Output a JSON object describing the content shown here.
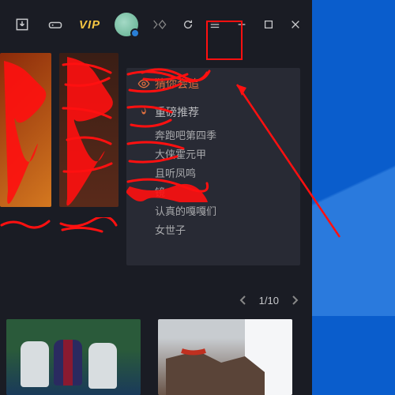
{
  "titlebar": {
    "vip_label": "VIP"
  },
  "dropdown": {
    "header": "猜你会追",
    "section_title": "重磅推荐",
    "items": [
      "奔跑吧第四季",
      "大侠霍元甲",
      "且听凤鸣",
      "镜",
      "认真的嘎嘎们",
      "女世子"
    ]
  },
  "pager": {
    "current": "1",
    "sep": "/",
    "total": "10"
  }
}
